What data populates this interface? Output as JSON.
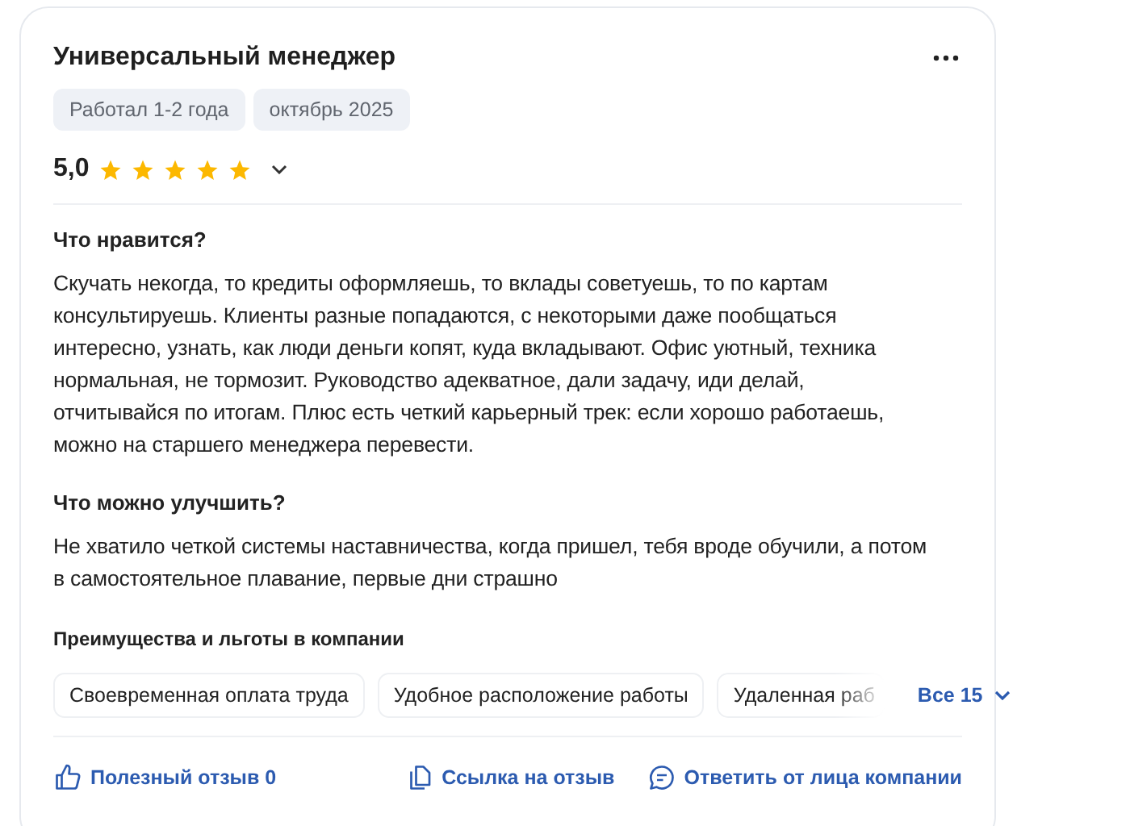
{
  "review": {
    "title": "Универсальный менеджер",
    "tags": [
      "Работал 1-2 года",
      "октябрь 2025"
    ],
    "rating": "5,0",
    "stars": 5,
    "sections": [
      {
        "heading": "Что нравится?",
        "text": "Скучать некогда, то кредиты оформляешь, то вклады советуешь, то по картам консультируешь. Клиенты разные попадаются, с некоторыми даже пообщаться интересно, узнать, как люди деньги копят, куда вкладывают. Офис уютный, техника нормальная, не тормозит. Руководство адекватное, дали задачу, иди делай, отчитывайся по итогам. Плюс есть четкий карьерный трек: если хорошо работаешь, можно на старшего менеджера перевести."
      },
      {
        "heading": "Что можно улучшить?",
        "text": "Не хватило четкой системы наставничества, когда пришел, тебя вроде обучили, а потом в самостоятельное плавание, первые дни страшно"
      }
    ],
    "benefits": {
      "title": "Преимущества и льготы в компании",
      "items": [
        "Своевременная оплата труда",
        "Удобное расположение работы",
        "Удаленная раб"
      ],
      "more": "Все 15"
    },
    "actions": [
      {
        "kind": "like",
        "label": "Полезный отзыв 0"
      },
      {
        "kind": "link",
        "label": "Ссылка на отзыв"
      },
      {
        "kind": "reply",
        "label": "Ответить от лица компании"
      }
    ]
  }
}
